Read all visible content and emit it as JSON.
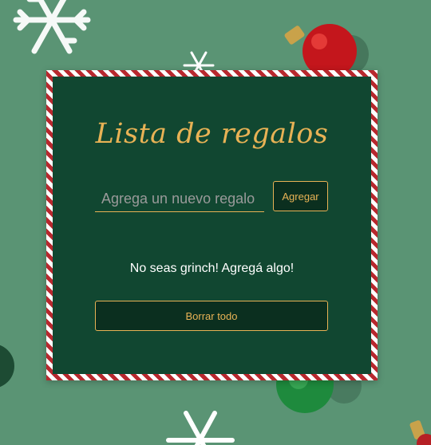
{
  "app": {
    "title": "Lista de regalos",
    "input": {
      "placeholder": "Agrega un nuevo regalo",
      "value": ""
    },
    "add_button_label": "Agregar",
    "empty_message": "No seas grinch! Agregá algo!",
    "clear_button_label": "Borrar todo"
  },
  "colors": {
    "background": "#5a9474",
    "card": "#114731",
    "accent": "#e8b255",
    "stripe_red": "#b8282e",
    "stripe_white": "#ffffff"
  },
  "decorations": [
    "snowflake-icon",
    "red-ornament-icon",
    "green-ornament-icon",
    "gold-ornament-icon"
  ]
}
